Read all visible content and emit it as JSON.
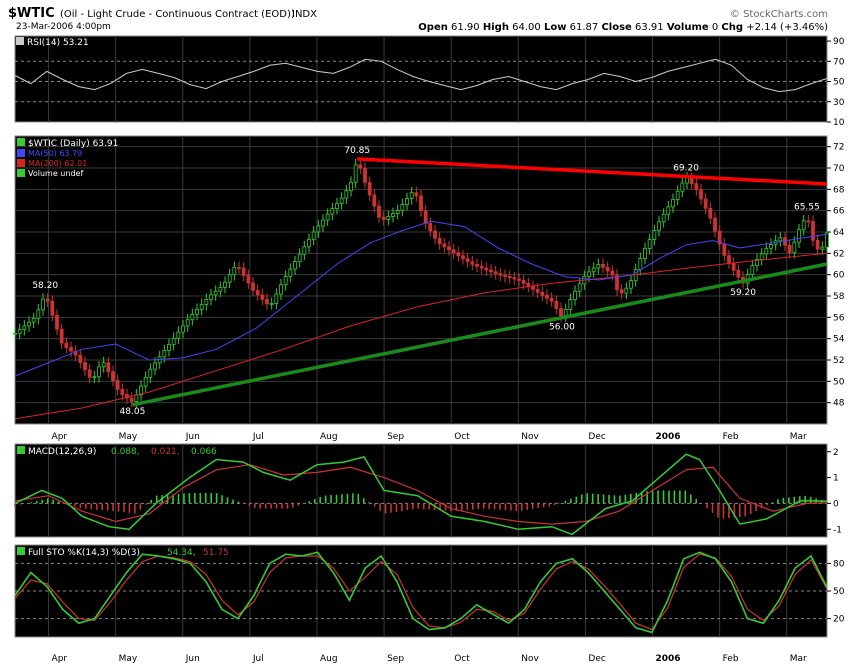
{
  "header": {
    "symbol": "$WTIC",
    "description": "(Oil - Light Crude - Continuous Contract (EOD))",
    "exchange": "INDX",
    "watermark": "© StockCharts.com",
    "date": "23-Mar-2006 4:00pm",
    "ohlc": {
      "open_label": "Open",
      "open": "61.90",
      "high_label": "High",
      "high": "64.00",
      "low_label": "Low",
      "low": "61.87",
      "close_label": "Close",
      "close": "63.91",
      "volume_label": "Volume",
      "volume": "0",
      "chg_label": "Chg",
      "chg": "+2.14 (+3.46%)"
    }
  },
  "colors": {
    "background": "#000000",
    "grid": "#3a3a3a",
    "candle_up": "#33cc33",
    "candle_down": "#cc3333",
    "ma50": "#4444ff",
    "ma200": "#dd2222",
    "resistance": "#ff0000",
    "support": "#1a8a1a",
    "rsi_line": "#cccccc",
    "stoch_k": "#33cc33",
    "stoch_d": "#cc3333",
    "macd_line": "#33cc33",
    "signal_line": "#cc3333"
  },
  "months": [
    "Apr",
    "May",
    "Jun",
    "Jul",
    "Aug",
    "Sep",
    "Oct",
    "Nov",
    "Dec",
    "2006",
    "Feb",
    "Mar"
  ],
  "chart_data": [
    {
      "type": "line",
      "panel": "rsi",
      "title": "RSI(14) 53.21",
      "ylim": [
        10,
        95
      ],
      "yticks": [
        "90",
        "70",
        "50",
        "30",
        "10"
      ],
      "ref_lines": [
        70,
        50,
        30
      ],
      "series": [
        {
          "name": "RSI(14)",
          "values": [
            56,
            48,
            60,
            52,
            45,
            42,
            48,
            58,
            62,
            58,
            54,
            47,
            43,
            50,
            55,
            60,
            66,
            68,
            64,
            60,
            58,
            64,
            72,
            70,
            62,
            55,
            50,
            46,
            42,
            46,
            52,
            55,
            50,
            45,
            42,
            48,
            52,
            58,
            55,
            50,
            54,
            60,
            64,
            68,
            72,
            66,
            52,
            44,
            40,
            42,
            48,
            53
          ]
        }
      ]
    },
    {
      "type": "candlestick",
      "panel": "price",
      "title": "$WTIC (Daily) 63.91",
      "legend": [
        "MA(50) 63.79",
        "MA(200) 62.01",
        "Volume undef"
      ],
      "ylim": [
        46,
        73
      ],
      "yticks": [
        "72",
        "70",
        "68",
        "66",
        "64",
        "62",
        "60",
        "58",
        "56",
        "54",
        "52",
        "50",
        "48"
      ],
      "x": [
        "Apr",
        "May",
        "Jun",
        "Jul",
        "Aug",
        "Sep",
        "Oct",
        "Nov",
        "Dec",
        "2006",
        "Feb",
        "Mar"
      ],
      "close_path": [
        [
          0.0,
          54.5
        ],
        [
          0.3,
          56.0
        ],
        [
          0.45,
          58.2
        ],
        [
          0.7,
          53.5
        ],
        [
          0.9,
          52.5
        ],
        [
          1.15,
          50.0
        ],
        [
          1.3,
          52.0
        ],
        [
          1.55,
          49.0
        ],
        [
          1.75,
          48.05
        ],
        [
          2.0,
          51.0
        ],
        [
          2.3,
          53.5
        ],
        [
          2.6,
          56.0
        ],
        [
          2.9,
          58.0
        ],
        [
          3.1,
          59.0
        ],
        [
          3.3,
          61.0
        ],
        [
          3.55,
          58.5
        ],
        [
          3.8,
          57.0
        ],
        [
          4.0,
          59.5
        ],
        [
          4.25,
          62.0
        ],
        [
          4.45,
          64.0
        ],
        [
          4.7,
          66.0
        ],
        [
          4.85,
          67.0
        ],
        [
          5.0,
          68.5
        ],
        [
          5.1,
          70.85
        ],
        [
          5.25,
          68.0
        ],
        [
          5.45,
          65.0
        ],
        [
          5.7,
          66.0
        ],
        [
          5.95,
          68.0
        ],
        [
          6.1,
          65.0
        ],
        [
          6.3,
          63.0
        ],
        [
          6.55,
          62.0
        ],
        [
          6.8,
          61.0
        ],
        [
          7.0,
          60.5
        ],
        [
          7.2,
          60.0
        ],
        [
          7.5,
          59.5
        ],
        [
          7.75,
          58.5
        ],
        [
          8.0,
          57.5
        ],
        [
          8.15,
          56.0
        ],
        [
          8.3,
          58.0
        ],
        [
          8.5,
          60.0
        ],
        [
          8.7,
          61.0
        ],
        [
          8.9,
          60.0
        ],
        [
          9.0,
          58.0
        ],
        [
          9.15,
          59.0
        ],
        [
          9.35,
          62.0
        ],
        [
          9.6,
          65.0
        ],
        [
          9.8,
          67.0
        ],
        [
          10.0,
          69.2
        ],
        [
          10.15,
          68.0
        ],
        [
          10.35,
          65.5
        ],
        [
          10.55,
          62.0
        ],
        [
          10.75,
          60.0
        ],
        [
          10.85,
          59.2
        ],
        [
          11.0,
          61.0
        ],
        [
          11.2,
          62.5
        ],
        [
          11.4,
          63.5
        ],
        [
          11.55,
          62.0
        ],
        [
          11.7,
          64.5
        ],
        [
          11.8,
          65.55
        ],
        [
          11.9,
          63.0
        ],
        [
          12.0,
          62.0
        ],
        [
          12.1,
          63.91
        ]
      ],
      "series": [
        {
          "name": "MA(50)",
          "points": [
            [
              0.0,
              50.5
            ],
            [
              1.0,
              53.0
            ],
            [
              1.5,
              53.5
            ],
            [
              2.0,
              52.0
            ],
            [
              2.5,
              52.2
            ],
            [
              3.0,
              53.0
            ],
            [
              3.6,
              55.0
            ],
            [
              4.2,
              58.0
            ],
            [
              4.8,
              61.0
            ],
            [
              5.3,
              63.0
            ],
            [
              5.8,
              64.2
            ],
            [
              6.2,
              65.0
            ],
            [
              6.7,
              64.5
            ],
            [
              7.2,
              62.5
            ],
            [
              7.7,
              61.0
            ],
            [
              8.2,
              59.8
            ],
            [
              8.7,
              59.5
            ],
            [
              9.2,
              60.0
            ],
            [
              9.6,
              61.5
            ],
            [
              10.0,
              62.8
            ],
            [
              10.4,
              63.2
            ],
            [
              10.8,
              62.5
            ],
            [
              11.3,
              63.0
            ],
            [
              11.8,
              63.5
            ],
            [
              12.1,
              63.79
            ]
          ]
        },
        {
          "name": "MA(200)",
          "points": [
            [
              0.0,
              46.5
            ],
            [
              1.0,
              47.5
            ],
            [
              2.0,
              49.0
            ],
            [
              3.0,
              51.0
            ],
            [
              4.0,
              53.0
            ],
            [
              5.0,
              55.2
            ],
            [
              6.0,
              57.0
            ],
            [
              7.0,
              58.3
            ],
            [
              8.0,
              59.2
            ],
            [
              9.0,
              59.8
            ],
            [
              10.0,
              60.6
            ],
            [
              11.0,
              61.3
            ],
            [
              12.1,
              62.01
            ]
          ]
        },
        {
          "name": "Resistance",
          "points": [
            [
              5.1,
              70.85
            ],
            [
              12.1,
              68.5
            ]
          ]
        },
        {
          "name": "Support",
          "points": [
            [
              1.75,
              47.8
            ],
            [
              12.1,
              61.0
            ]
          ]
        }
      ],
      "annotations": [
        {
          "label": "58.20",
          "x": 0.45,
          "y": 58.2,
          "pos": "above"
        },
        {
          "label": "48.05",
          "x": 1.75,
          "y": 48.05,
          "pos": "below"
        },
        {
          "label": "70.85",
          "x": 5.1,
          "y": 70.85,
          "pos": "above"
        },
        {
          "label": "56.00",
          "x": 8.15,
          "y": 56.0,
          "pos": "below"
        },
        {
          "label": "69.20",
          "x": 10.0,
          "y": 69.2,
          "pos": "above"
        },
        {
          "label": "59.20",
          "x": 10.85,
          "y": 59.2,
          "pos": "below"
        },
        {
          "label": "65.55",
          "x": 11.8,
          "y": 65.55,
          "pos": "above"
        }
      ]
    },
    {
      "type": "line",
      "panel": "macd",
      "title": "MACD(12,26,9)",
      "legend": [
        "0.088",
        "0.021",
        "0.066"
      ],
      "ylim": [
        -1.3,
        2.3
      ],
      "yticks": [
        "2",
        "1",
        "0",
        "-1"
      ],
      "series": [
        {
          "name": "MACD",
          "points": [
            [
              0.0,
              0.0
            ],
            [
              0.4,
              0.5
            ],
            [
              0.7,
              0.2
            ],
            [
              1.0,
              -0.5
            ],
            [
              1.4,
              -0.9
            ],
            [
              1.7,
              -1.0
            ],
            [
              2.1,
              0.0
            ],
            [
              2.6,
              1.0
            ],
            [
              3.0,
              1.7
            ],
            [
              3.4,
              1.6
            ],
            [
              3.7,
              1.2
            ],
            [
              4.1,
              0.9
            ],
            [
              4.5,
              1.5
            ],
            [
              4.9,
              1.6
            ],
            [
              5.2,
              1.8
            ],
            [
              5.5,
              0.5
            ],
            [
              6.0,
              0.3
            ],
            [
              6.5,
              -0.5
            ],
            [
              7.0,
              -0.7
            ],
            [
              7.5,
              -1.0
            ],
            [
              8.0,
              -0.9
            ],
            [
              8.3,
              -1.2
            ],
            [
              8.8,
              -0.2
            ],
            [
              9.2,
              0.1
            ],
            [
              9.6,
              1.0
            ],
            [
              10.0,
              1.9
            ],
            [
              10.2,
              1.7
            ],
            [
              10.5,
              0.5
            ],
            [
              10.8,
              -0.8
            ],
            [
              11.2,
              -0.6
            ],
            [
              11.7,
              0.1
            ],
            [
              12.1,
              0.088
            ]
          ]
        },
        {
          "name": "Signal",
          "points": [
            [
              0.0,
              0.1
            ],
            [
              0.5,
              0.3
            ],
            [
              1.0,
              -0.3
            ],
            [
              1.5,
              -0.7
            ],
            [
              2.0,
              -0.4
            ],
            [
              2.5,
              0.6
            ],
            [
              3.0,
              1.3
            ],
            [
              3.5,
              1.5
            ],
            [
              4.0,
              1.1
            ],
            [
              4.5,
              1.2
            ],
            [
              5.0,
              1.4
            ],
            [
              5.5,
              1.0
            ],
            [
              6.0,
              0.5
            ],
            [
              6.5,
              -0.2
            ],
            [
              7.0,
              -0.5
            ],
            [
              7.5,
              -0.7
            ],
            [
              8.0,
              -0.8
            ],
            [
              8.5,
              -0.7
            ],
            [
              9.0,
              -0.3
            ],
            [
              9.5,
              0.5
            ],
            [
              10.0,
              1.3
            ],
            [
              10.4,
              1.4
            ],
            [
              10.8,
              0.2
            ],
            [
              11.3,
              -0.3
            ],
            [
              11.8,
              0.0
            ],
            [
              12.1,
              0.021
            ]
          ]
        },
        {
          "name": "Histogram",
          "points": [
            [
              0.0,
              -0.1
            ],
            [
              0.5,
              0.2
            ],
            [
              1.0,
              -0.2
            ],
            [
              1.5,
              -0.3
            ],
            [
              1.8,
              -0.4
            ],
            [
              2.1,
              0.3
            ],
            [
              2.6,
              0.4
            ],
            [
              3.0,
              0.4
            ],
            [
              3.6,
              -0.2
            ],
            [
              4.1,
              -0.2
            ],
            [
              4.6,
              0.3
            ],
            [
              5.1,
              0.4
            ],
            [
              5.5,
              -0.4
            ],
            [
              6.0,
              -0.2
            ],
            [
              6.5,
              -0.3
            ],
            [
              7.0,
              -0.2
            ],
            [
              7.5,
              -0.3
            ],
            [
              8.0,
              -0.1
            ],
            [
              8.5,
              0.4
            ],
            [
              9.0,
              0.3
            ],
            [
              9.5,
              0.5
            ],
            [
              10.0,
              0.5
            ],
            [
              10.5,
              -0.6
            ],
            [
              10.9,
              -0.5
            ],
            [
              11.4,
              0.2
            ],
            [
              11.8,
              0.3
            ],
            [
              12.1,
              0.066
            ]
          ]
        }
      ]
    },
    {
      "type": "line",
      "panel": "stochastic",
      "title": "Full STO %K(14,3) %D(3)",
      "legend": [
        "54.34",
        "51.75"
      ],
      "ylim": [
        0,
        100
      ],
      "yticks": [
        "80",
        "50",
        "20"
      ],
      "ref_lines": [
        80,
        50,
        20
      ],
      "series": [
        {
          "name": "%K(14,3)",
          "values": [
            45,
            70,
            55,
            30,
            15,
            20,
            45,
            70,
            90,
            88,
            85,
            80,
            60,
            30,
            20,
            45,
            80,
            90,
            88,
            92,
            70,
            40,
            75,
            88,
            60,
            20,
            8,
            10,
            20,
            35,
            25,
            15,
            30,
            60,
            80,
            85,
            70,
            50,
            30,
            10,
            5,
            40,
            85,
            92,
            85,
            60,
            20,
            15,
            40,
            75,
            88,
            54
          ]
        },
        {
          "name": "%D(3)",
          "values": [
            42,
            62,
            58,
            38,
            20,
            18,
            38,
            62,
            82,
            88,
            86,
            82,
            68,
            40,
            24,
            38,
            70,
            86,
            88,
            88,
            75,
            50,
            65,
            82,
            68,
            32,
            12,
            10,
            16,
            30,
            28,
            18,
            26,
            52,
            74,
            82,
            74,
            56,
            36,
            15,
            8,
            32,
            76,
            90,
            86,
            66,
            30,
            18,
            34,
            68,
            84,
            52
          ]
        }
      ]
    }
  ]
}
